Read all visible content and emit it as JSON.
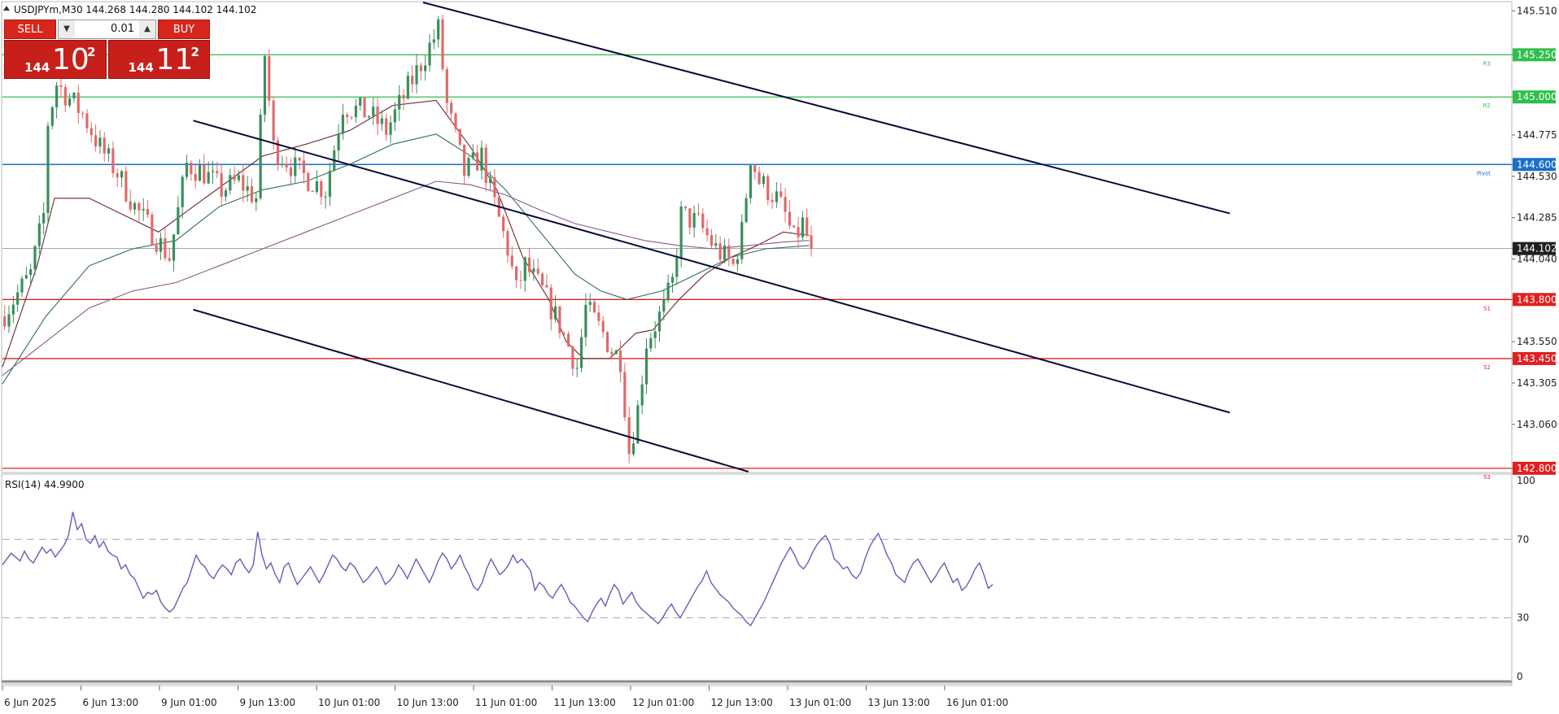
{
  "symbol_header": "USDJPYm,M30  144.268 144.280 144.102 144.102",
  "trade_panel": {
    "sell_label": "SELL",
    "buy_label": "BUY",
    "lot": "0.01",
    "sell_quote": {
      "prefix": "144",
      "big": "10",
      "sup": "2"
    },
    "buy_quote": {
      "prefix": "144",
      "big": "11",
      "sup": "2"
    }
  },
  "colors": {
    "bull": "#3a8f5c",
    "bear": "#e06a6a",
    "resistance": "#2fbf4a",
    "support": "#e02020",
    "pivot": "#1a6fc9",
    "channel": "#0a0a3a",
    "rsi": "#6b5bb5",
    "ma_fast": "#6b2a2a",
    "ma_mid": "#2e6b62",
    "ma_slow": "#8a5a8a"
  },
  "chart_data": [
    {
      "type": "candlestick",
      "ylim": [
        142.78,
        145.56
      ],
      "y_ticks": [
        "145.510",
        "145.250",
        "145.000",
        "144.775",
        "144.600",
        "144.530",
        "144.285",
        "144.102",
        "144.040",
        "143.800",
        "143.550",
        "143.450",
        "143.305",
        "143.060",
        "142.800"
      ],
      "x_ticks": [
        "6 Jun 2025",
        "6 Jun 13:00",
        "9 Jun 01:00",
        "9 Jun 13:00",
        "10 Jun 01:00",
        "10 Jun 13:00",
        "11 Jun 01:00",
        "11 Jun 13:00",
        "12 Jun 01:00",
        "12 Jun 13:00",
        "13 Jun 01:00",
        "13 Jun 13:00",
        "16 Jun 01:00"
      ],
      "current_price": 144.102,
      "levels": [
        {
          "name": "R3",
          "value": 145.25,
          "kind": "resistance"
        },
        {
          "name": "R2",
          "value": 145.0,
          "kind": "resistance"
        },
        {
          "name": "Pivot",
          "value": 144.6,
          "kind": "pivot"
        },
        {
          "name": "S1",
          "value": 143.8,
          "kind": "support"
        },
        {
          "name": "S2",
          "value": 143.45,
          "kind": "support"
        },
        {
          "name": "S3",
          "value": 142.8,
          "kind": "support"
        }
      ],
      "close_path": [
        [
          0,
          143.72
        ],
        [
          6,
          143.95
        ],
        [
          9,
          144.3
        ],
        [
          10,
          144.85
        ],
        [
          12,
          145.08
        ],
        [
          18,
          144.9
        ],
        [
          22,
          144.7
        ],
        [
          26,
          144.55
        ],
        [
          30,
          144.35
        ],
        [
          34,
          144.2
        ],
        [
          38,
          144.05
        ],
        [
          42,
          144.6
        ],
        [
          46,
          144.55
        ],
        [
          50,
          144.45
        ],
        [
          54,
          144.5
        ],
        [
          58,
          144.4
        ],
        [
          60,
          145.25
        ],
        [
          62,
          144.7
        ],
        [
          68,
          144.55
        ],
        [
          74,
          144.45
        ],
        [
          78,
          144.95
        ],
        [
          84,
          144.9
        ],
        [
          88,
          144.8
        ],
        [
          92,
          145.0
        ],
        [
          96,
          145.2
        ],
        [
          100,
          145.4
        ],
        [
          102,
          144.95
        ],
        [
          106,
          144.55
        ],
        [
          110,
          144.65
        ],
        [
          112,
          144.45
        ],
        [
          116,
          144.1
        ],
        [
          118,
          143.85
        ],
        [
          120,
          144.0
        ],
        [
          124,
          143.85
        ],
        [
          128,
          143.65
        ],
        [
          132,
          143.4
        ],
        [
          134,
          143.75
        ],
        [
          138,
          143.6
        ],
        [
          140,
          143.5
        ],
        [
          142,
          143.45
        ],
        [
          144,
          142.9
        ],
        [
          146,
          143.15
        ],
        [
          148,
          143.55
        ],
        [
          150,
          143.65
        ],
        [
          152,
          143.75
        ],
        [
          154,
          143.9
        ],
        [
          156,
          144.3
        ],
        [
          160,
          144.25
        ],
        [
          164,
          144.1
        ],
        [
          168,
          144.0
        ],
        [
          170,
          144.2
        ],
        [
          172,
          144.65
        ],
        [
          174,
          144.5
        ],
        [
          178,
          144.4
        ],
        [
          180,
          144.3
        ],
        [
          182,
          144.15
        ],
        [
          184,
          144.25
        ],
        [
          186,
          144.1
        ]
      ],
      "ma_paths": [
        {
          "name": "fast",
          "points": [
            [
              0,
              143.4
            ],
            [
              8,
              144.0
            ],
            [
              12,
              144.4
            ],
            [
              20,
              144.4
            ],
            [
              28,
              144.3
            ],
            [
              36,
              144.2
            ],
            [
              44,
              144.35
            ],
            [
              52,
              144.5
            ],
            [
              60,
              144.65
            ],
            [
              70,
              144.72
            ],
            [
              80,
              144.8
            ],
            [
              90,
              144.95
            ],
            [
              100,
              144.98
            ],
            [
              108,
              144.7
            ],
            [
              114,
              144.45
            ],
            [
              120,
              144.05
            ],
            [
              126,
              143.8
            ],
            [
              130,
              143.55
            ],
            [
              134,
              143.45
            ],
            [
              140,
              143.45
            ],
            [
              146,
              143.6
            ],
            [
              150,
              143.62
            ],
            [
              156,
              143.8
            ],
            [
              162,
              143.95
            ],
            [
              168,
              144.05
            ],
            [
              174,
              144.12
            ],
            [
              180,
              144.2
            ],
            [
              186,
              144.18
            ]
          ]
        },
        {
          "name": "mid",
          "points": [
            [
              0,
              143.3
            ],
            [
              10,
              143.7
            ],
            [
              20,
              144.0
            ],
            [
              30,
              144.1
            ],
            [
              40,
              144.15
            ],
            [
              50,
              144.35
            ],
            [
              60,
              144.45
            ],
            [
              70,
              144.5
            ],
            [
              80,
              144.6
            ],
            [
              90,
              144.72
            ],
            [
              100,
              144.78
            ],
            [
              108,
              144.65
            ],
            [
              116,
              144.45
            ],
            [
              124,
              144.2
            ],
            [
              132,
              143.95
            ],
            [
              138,
              143.85
            ],
            [
              144,
              143.8
            ],
            [
              152,
              143.85
            ],
            [
              160,
              143.95
            ],
            [
              168,
              144.05
            ],
            [
              176,
              144.1
            ],
            [
              186,
              144.12
            ]
          ]
        },
        {
          "name": "slow",
          "points": [
            [
              0,
              143.35
            ],
            [
              10,
              143.55
            ],
            [
              20,
              143.75
            ],
            [
              30,
              143.85
            ],
            [
              40,
              143.9
            ],
            [
              50,
              144.0
            ],
            [
              60,
              144.1
            ],
            [
              70,
              144.2
            ],
            [
              80,
              144.3
            ],
            [
              90,
              144.4
            ],
            [
              100,
              144.5
            ],
            [
              108,
              144.48
            ],
            [
              116,
              144.42
            ],
            [
              124,
              144.33
            ],
            [
              132,
              144.25
            ],
            [
              140,
              144.2
            ],
            [
              148,
              144.15
            ],
            [
              156,
              144.12
            ],
            [
              164,
              144.1
            ],
            [
              172,
              144.12
            ],
            [
              180,
              144.14
            ],
            [
              186,
              144.15
            ]
          ]
        }
      ],
      "channel_lines": [
        {
          "name": "upper-channel",
          "from": [
            97,
            145.56
          ],
          "to": [
            283,
            144.31
          ]
        },
        {
          "name": "middle-channel",
          "from": [
            44,
            144.86
          ],
          "to": [
            283,
            143.13
          ]
        },
        {
          "name": "lower-channel",
          "from": [
            44,
            143.74
          ],
          "to": [
            172,
            142.78
          ]
        }
      ]
    },
    {
      "type": "line",
      "title": "RSI(14) 44.9900",
      "ylim": [
        0,
        100
      ],
      "y_ticks": [
        "100",
        "70",
        "30",
        "0"
      ],
      "dashed_levels": [
        70,
        30
      ],
      "values": [
        57,
        60,
        63,
        61,
        59,
        64,
        60,
        58,
        62,
        66,
        63,
        65,
        61,
        64,
        67,
        72,
        84,
        75,
        78,
        70,
        68,
        72,
        66,
        69,
        64,
        62,
        61,
        55,
        57,
        52,
        50,
        45,
        40,
        43,
        42,
        44,
        38,
        35,
        33,
        35,
        40,
        45,
        48,
        55,
        62,
        58,
        56,
        52,
        50,
        54,
        57,
        55,
        52,
        58,
        60,
        56,
        53,
        57,
        74,
        62,
        55,
        58,
        52,
        48,
        56,
        58,
        52,
        47,
        50,
        53,
        56,
        52,
        48,
        52,
        57,
        62,
        60,
        56,
        54,
        58,
        56,
        52,
        48,
        50,
        53,
        56,
        52,
        47,
        49,
        52,
        57,
        54,
        50,
        55,
        60,
        56,
        52,
        48,
        53,
        59,
        63,
        60,
        55,
        58,
        62,
        56,
        52,
        46,
        44,
        48,
        55,
        60,
        56,
        52,
        54,
        57,
        62,
        58,
        60,
        57,
        54,
        44,
        48,
        46,
        42,
        40,
        44,
        47,
        43,
        38,
        36,
        33,
        30,
        28,
        33,
        37,
        40,
        36,
        42,
        47,
        44,
        37,
        40,
        43,
        38,
        35,
        33,
        31,
        29,
        27,
        30,
        34,
        37,
        33,
        30,
        34,
        38,
        42,
        46,
        49,
        54,
        48,
        45,
        42,
        40,
        38,
        35,
        33,
        31,
        28,
        26,
        30,
        34,
        38,
        43,
        48,
        53,
        58,
        62,
        66,
        62,
        57,
        55,
        58,
        63,
        67,
        70,
        72,
        68,
        60,
        58,
        55,
        56,
        52,
        50,
        53,
        60,
        66,
        70,
        73,
        68,
        62,
        58,
        52,
        50,
        48,
        54,
        58,
        60,
        56,
        52,
        48,
        51,
        55,
        58,
        53,
        48,
        50,
        44,
        46,
        50,
        55,
        58,
        52,
        45,
        47
      ]
    }
  ]
}
